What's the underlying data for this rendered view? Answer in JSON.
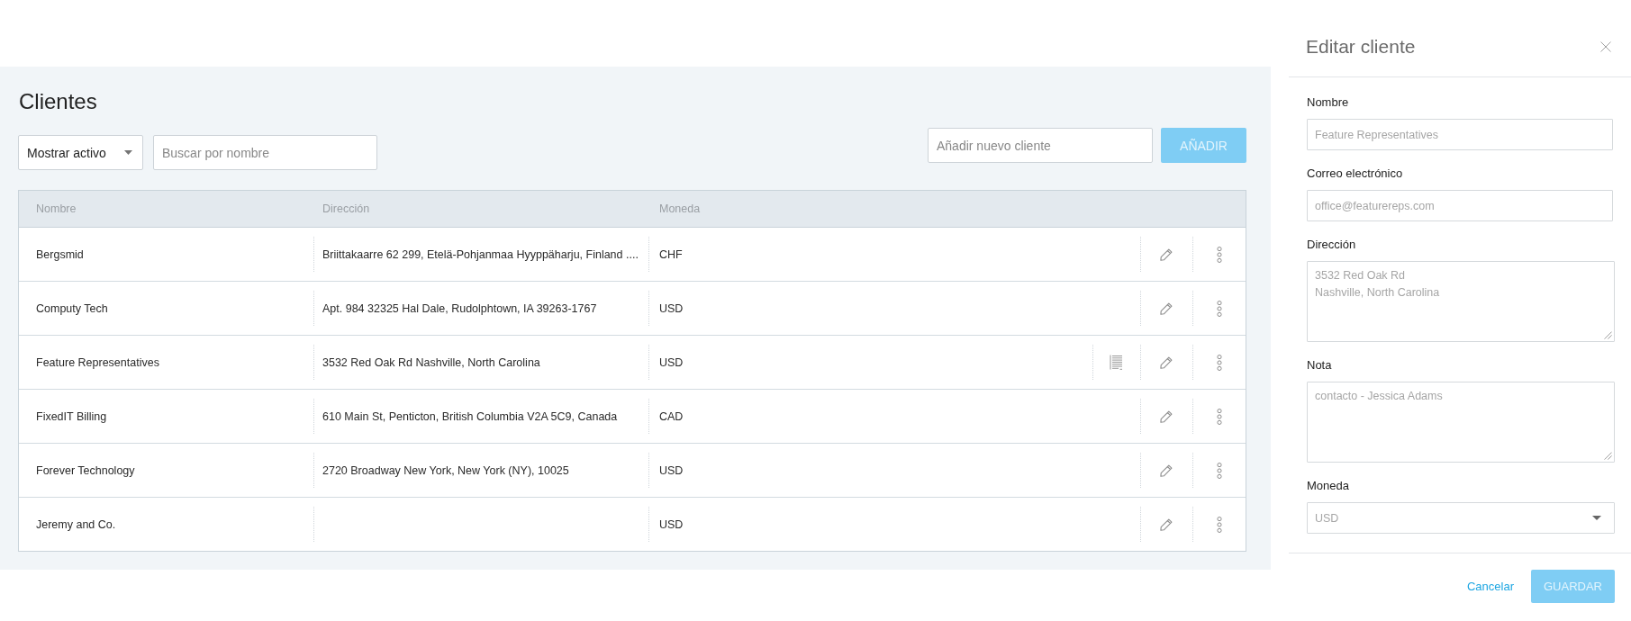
{
  "page": {
    "title": "Clientes"
  },
  "toolbar": {
    "status_filter": {
      "value": "Mostrar activo"
    },
    "search": {
      "placeholder": "Buscar por nombre"
    },
    "new_client": {
      "placeholder": "Añadir nuevo cliente"
    },
    "add_button": {
      "label": "AÑADIR",
      "disabled": true
    }
  },
  "table": {
    "columns": [
      "Nombre",
      "Dirección",
      "Moneda"
    ],
    "rows": [
      {
        "name": "Bergsmid",
        "address": "Briittakaarre 62 299, Etelä-Pohjanmaa Hyyppäharju, Finland ....",
        "currency": "CHF",
        "has_note": false
      },
      {
        "name": "Computy Tech",
        "address": "Apt. 984 32325 Hal Dale, Rudolphtown, IA 39263-1767",
        "currency": "USD",
        "has_note": false
      },
      {
        "name": "Feature Representatives",
        "address": "3532 Red Oak Rd Nashville, North Carolina",
        "currency": "USD",
        "has_note": true
      },
      {
        "name": "FixedIT Billing",
        "address": "610 Main St, Penticton, British Columbia V2A 5C9, Canada",
        "currency": "CAD",
        "has_note": false
      },
      {
        "name": "Forever Technology",
        "address": "2720 Broadway New York, New York (NY), 10025",
        "currency": "USD",
        "has_note": false
      },
      {
        "name": "Jeremy and Co.",
        "currency": "USD",
        "has_note": false
      }
    ]
  },
  "edit_panel": {
    "title": "Editar cliente",
    "fields": [
      {
        "kind": "input",
        "label": "Nombre",
        "value": "Feature Representatives"
      },
      {
        "kind": "input",
        "label": "Correo electrónico",
        "value": "office@featurereps.com"
      },
      {
        "kind": "textarea",
        "label": "Dirección",
        "value": "3532 Red Oak Rd\nNashville, North Carolina"
      },
      {
        "kind": "textarea",
        "label": "Nota",
        "value": "contacto - Jessica Adams"
      },
      {
        "kind": "select",
        "label": "Moneda",
        "value": "USD"
      }
    ],
    "cancel_link": "Cancelar",
    "save_button": {
      "label": "GUARDAR",
      "disabled": true
    }
  }
}
